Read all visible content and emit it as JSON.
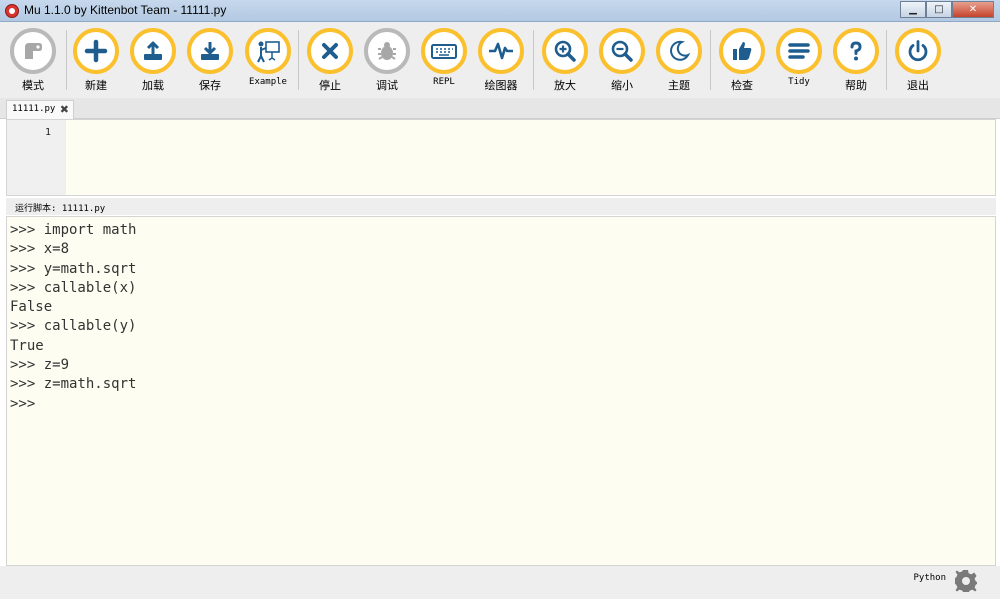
{
  "window": {
    "title": "Mu 1.1.0 by Kittenbot Team - 11111.py",
    "controls": {
      "minimize": "▁",
      "maximize": "□",
      "close": "✕"
    }
  },
  "toolbar": {
    "buttons": [
      {
        "label": "模式",
        "icon": "mode-icon"
      },
      {
        "label": "新建",
        "icon": "plus-icon"
      },
      {
        "label": "加载",
        "icon": "upload-icon"
      },
      {
        "label": "保存",
        "icon": "download-icon"
      },
      {
        "label": "Example",
        "icon": "presentation-icon"
      },
      {
        "label": "停止",
        "icon": "close-icon"
      },
      {
        "label": "调试",
        "icon": "bug-icon"
      },
      {
        "label": "REPL",
        "icon": "keyboard-icon"
      },
      {
        "label": "绘图器",
        "icon": "pulse-icon"
      },
      {
        "label": "放大",
        "icon": "zoom-in-icon"
      },
      {
        "label": "缩小",
        "icon": "zoom-out-icon"
      },
      {
        "label": "主题",
        "icon": "moon-icon"
      },
      {
        "label": "检查",
        "icon": "thumbs-up-icon"
      },
      {
        "label": "Tidy",
        "icon": "lines-icon"
      },
      {
        "label": "帮助",
        "icon": "question-icon"
      },
      {
        "label": "退出",
        "icon": "power-icon"
      }
    ]
  },
  "tabs": [
    {
      "label": "11111.py",
      "close": "✖"
    }
  ],
  "editor": {
    "line_numbers": [
      "1"
    ]
  },
  "repl": {
    "title": "运行脚本: 11111.py",
    "lines": [
      ">>> import math",
      ">>> x=8",
      ">>> y=math.sqrt",
      ">>> callable(x)",
      "False",
      ">>> callable(y)",
      "True",
      ">>> z=9",
      ">>> z=math.sqrt",
      ">>>"
    ]
  },
  "status": {
    "mode": "Python",
    "settings_icon": "gear-icon"
  },
  "colors": {
    "accent": "#fbc02d",
    "icon": "#1f5d8f",
    "disabled": "#b9b9b9",
    "editor_bg": "#fefdf2"
  }
}
